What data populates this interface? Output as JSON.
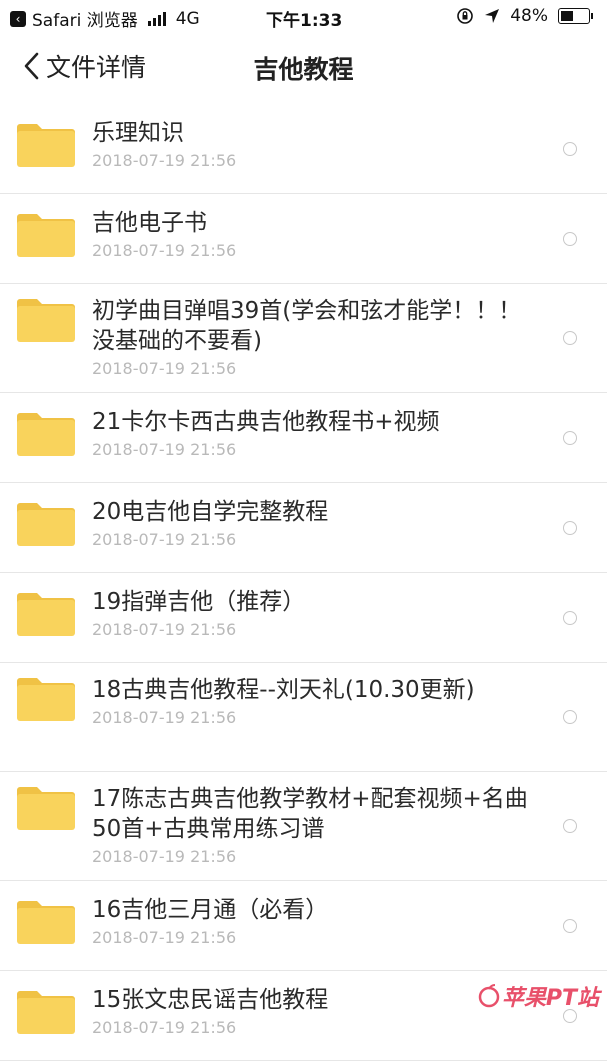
{
  "status_bar": {
    "app_name": "Safari 浏览器",
    "network": "4G",
    "time": "下午1:33",
    "battery_text": "48%",
    "battery_level": 0.48
  },
  "nav": {
    "back_label": "文件详情",
    "title": "吉他教程"
  },
  "folders": [
    {
      "title": "乐理知识",
      "date": "2018-07-19 21:56"
    },
    {
      "title": "吉他电子书",
      "date": "2018-07-19 21:56"
    },
    {
      "title": "初学曲目弹唱39首(学会和弦才能学！！！没基础的不要看)",
      "date": "2018-07-19 21:56"
    },
    {
      "title": "21卡尔卡西古典吉他教程书+视频",
      "date": "2018-07-19 21:56"
    },
    {
      "title": "20电吉他自学完整教程",
      "date": "2018-07-19 21:56"
    },
    {
      "title": "19指弹吉他（推荐）",
      "date": "2018-07-19 21:56"
    },
    {
      "title": "18古典吉他教程--刘天礼(10.30更新)",
      "date": "2018-07-19 21:56"
    },
    {
      "title": "17陈志古典吉他教学教材+配套视频+名曲50首+古典常用练习谱",
      "date": "2018-07-19 21:56"
    },
    {
      "title": "16吉他三月通（必看）",
      "date": "2018-07-19 21:56"
    },
    {
      "title": "15张文忠民谣吉他教程",
      "date": "2018-07-19 21:56"
    }
  ],
  "watermark": "苹果PT站",
  "colors": {
    "folder": "#f9d35c",
    "folder_tab": "#f0c245",
    "date_text": "#b9b9b9",
    "divider": "#e6e6e6"
  }
}
